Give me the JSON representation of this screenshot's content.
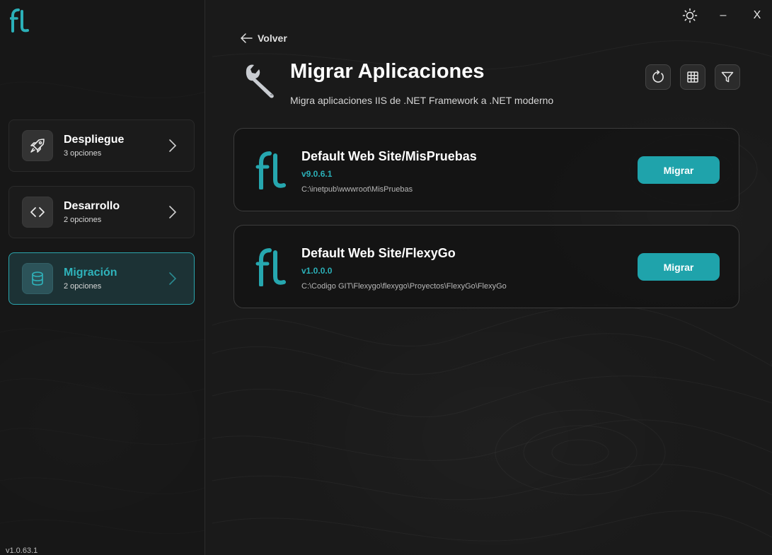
{
  "app": {
    "version": "v1.0.63.1"
  },
  "window": {
    "minimize_label": "–",
    "close_label": "X"
  },
  "sidebar": {
    "items": [
      {
        "title": "Despliegue",
        "subtitle": "3 opciones",
        "icon": "rocket-icon"
      },
      {
        "title": "Desarrollo",
        "subtitle": "2 opciones",
        "icon": "code-icon"
      },
      {
        "title": "Migración",
        "subtitle": "2 opciones",
        "icon": "database-icon",
        "active": true
      }
    ]
  },
  "header": {
    "back_label": "Volver",
    "title": "Migrar Aplicaciones",
    "subtitle": "Migra aplicaciones IIS de .NET Framework a .NET moderno",
    "icon": "wrench-icon",
    "tools": [
      "refresh-icon",
      "grid-icon",
      "filter-icon"
    ]
  },
  "apps": [
    {
      "name": "Default Web Site/MisPruebas",
      "version": "v9.0.6.1",
      "path": "C:\\inetpub\\wwwroot\\MisPruebas",
      "action": "Migrar"
    },
    {
      "name": "Default Web Site/FlexyGo",
      "version": "v1.0.0.0",
      "path": "C:\\Codigo GIT\\Flexygo\\flexygo\\Proyectos\\FlexyGo\\FlexyGo",
      "action": "Migrar"
    }
  ],
  "colors": {
    "accent": "#1fa3ab",
    "accent_text": "#2bb0b8",
    "background": "#1a1a1a"
  }
}
